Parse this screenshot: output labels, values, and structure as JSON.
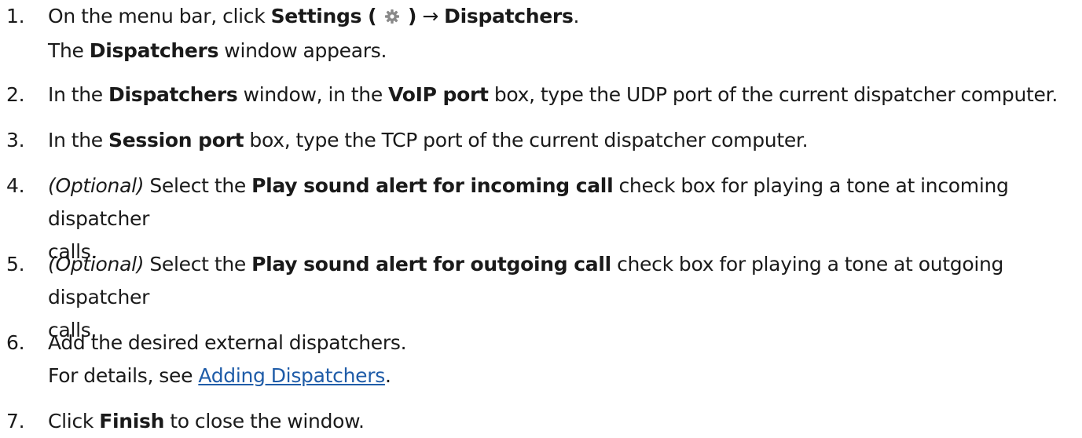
{
  "steps": [
    {
      "number": "1.",
      "line1": {
        "pre": "On the menu bar, click ",
        "b1": "Settings (",
        "b2": ")",
        "arrow": " → ",
        "b3": "Dispatchers",
        "post": "."
      },
      "line2": {
        "pre": "The ",
        "b1": "Dispatchers",
        "post": " window appears."
      },
      "icon": "gear-icon"
    },
    {
      "number": "2.",
      "pre": "In the ",
      "b1": "Dispatchers",
      "mid1": " window, in the ",
      "b2": "VoIP port",
      "post": " box, type the UDP port of the current dispatcher computer."
    },
    {
      "number": "3.",
      "pre": "In the ",
      "b1": "Session port",
      "post": " box, type the TCP port of the current dispatcher computer."
    },
    {
      "number": "4.",
      "optional": "(Optional)",
      "pre": " Select the ",
      "b1": "Play sound alert for incoming call",
      "post1": " check box for playing a tone at incoming dispatcher",
      "post2": "calls."
    },
    {
      "number": "5.",
      "optional": "(Optional)",
      "pre": " Select the ",
      "b1": "Play sound alert for outgoing call",
      "post1": " check box for playing a tone at outgoing dispatcher",
      "post2": "calls."
    },
    {
      "number": "6.",
      "line1": "Add the desired external dispatchers.",
      "line2_pre": "For details, see ",
      "link": "Adding Dispatchers",
      "line2_post": "."
    },
    {
      "number": "7.",
      "pre": "Click ",
      "b1": "Finish",
      "post": " to close the window."
    }
  ],
  "colors": {
    "text": "#1a1a1a",
    "link": "#1f5ca8",
    "icon": "#8a8a8a"
  }
}
